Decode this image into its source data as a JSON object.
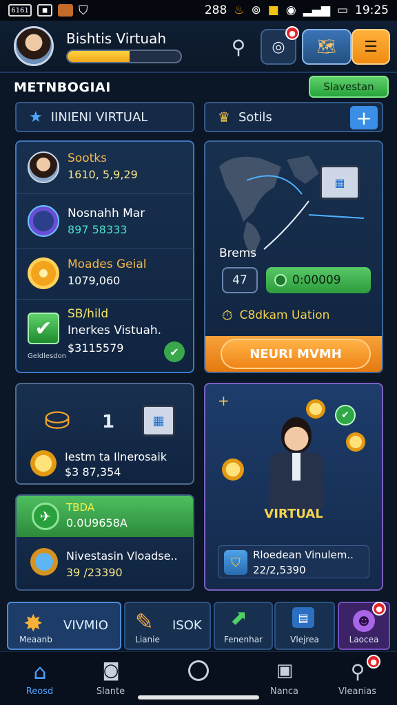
{
  "status_bar": {
    "left_box_1": "6161",
    "right_text": "288",
    "time": "19:25"
  },
  "header": {
    "username": "Bishtis Virtuah",
    "xp_progress": 0.55
  },
  "section": {
    "title": "METNBOGIAI",
    "action_label": "Slavestan"
  },
  "tabs": {
    "left_label": "IINIENI VIRTUAL",
    "right_label": "Sotils"
  },
  "left_list": [
    {
      "title": "Sootks",
      "value": "1610, 5,9,29"
    },
    {
      "title": "Nosnahh Mar",
      "value": "897 58333"
    },
    {
      "title": "Moades Geial",
      "value": "1079,060"
    },
    {
      "title": "SB/hild",
      "subtitle": "Inerkes Vistuah.",
      "value": "$3115579",
      "caption": "Geldlesdon"
    }
  ],
  "map_card": {
    "label": "Brems",
    "count": "47",
    "balance": "0:00009",
    "status_text": "C8dkam Uation",
    "cta": "NEURI MVMH"
  },
  "card_chest": {
    "number": "1",
    "title": "Iestm ta Ilnerosaik",
    "value": "$3 87,354"
  },
  "card_green": {
    "title": "TBDA",
    "value": "0.0U9658A"
  },
  "card_invest": {
    "title": "Nivestasin Vloadse..",
    "value": "39 /23390"
  },
  "card_virtual": {
    "title": "VIRTUAL",
    "row_title": "Rloedean Vinulem..",
    "row_value": "22/2,5390"
  },
  "bottom_tabs": [
    {
      "label": "Meaanb",
      "title": "VIVMIO"
    },
    {
      "label": "Lianie",
      "title": "ISOK"
    },
    {
      "label": "Fenenhar"
    },
    {
      "label": "Vlejrea"
    },
    {
      "label": "Laocea"
    }
  ],
  "nav": [
    {
      "label": "Reosd"
    },
    {
      "label": "Slante"
    },
    {
      "label": ""
    },
    {
      "label": "Nanca"
    },
    {
      "label": "Vleanias"
    }
  ],
  "colors": {
    "accent_orange": "#f08518",
    "accent_green": "#28a33b",
    "panel_border": "#2e5688"
  }
}
